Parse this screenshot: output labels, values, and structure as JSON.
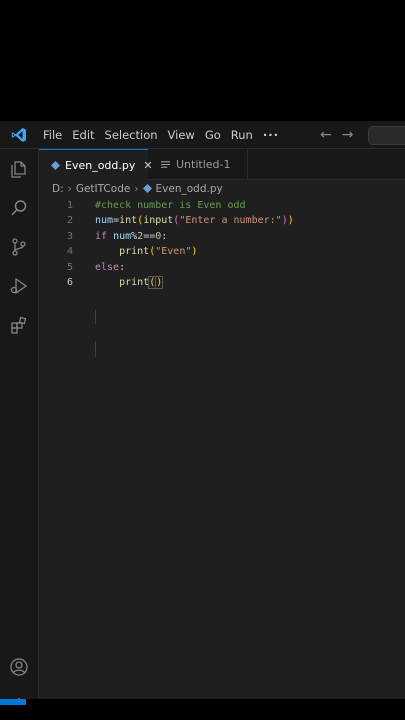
{
  "menu": {
    "items": [
      "File",
      "Edit",
      "Selection",
      "View",
      "Go",
      "Run",
      "···"
    ]
  },
  "tabs": [
    {
      "label": "Even_odd.py",
      "close": "✕"
    },
    {
      "label": "Untitled-1"
    }
  ],
  "breadcrumb": {
    "drive": "D:",
    "folder": "GetITCode",
    "file": "Even_odd.py"
  },
  "editor": {
    "line_numbers": [
      "1",
      "2",
      "3",
      "4",
      "5",
      "6"
    ],
    "line1": "#check number is Even odd",
    "line2": {
      "var": "num",
      "eq": "=",
      "fn1": "int",
      "p1": "(",
      "fn2": "input",
      "p2": "(",
      "str": "\"Enter a number:\"",
      "p3": ")",
      "p4": ")"
    },
    "line3": {
      "kw": "if",
      "var": " num",
      "op": "%",
      "n1": "2",
      "eq": "==",
      "n2": "0",
      "colon": ":"
    },
    "line4": {
      "fn": "print",
      "p1": "(",
      "str": "\"Even\"",
      "p2": ")"
    },
    "line5": {
      "kw": "else",
      "colon": ":"
    },
    "line6": {
      "fn": "print",
      "p1": "(",
      "p2": ")"
    }
  },
  "icons": {
    "activity": [
      "explorer-icon",
      "search-icon",
      "source-control-icon",
      "run-debug-icon",
      "extensions-icon",
      "account-icon",
      "settings-gear-icon"
    ]
  },
  "colors": {
    "accent": "#0078d4",
    "editor_bg": "#1f1f1f",
    "chrome_bg": "#181818"
  }
}
